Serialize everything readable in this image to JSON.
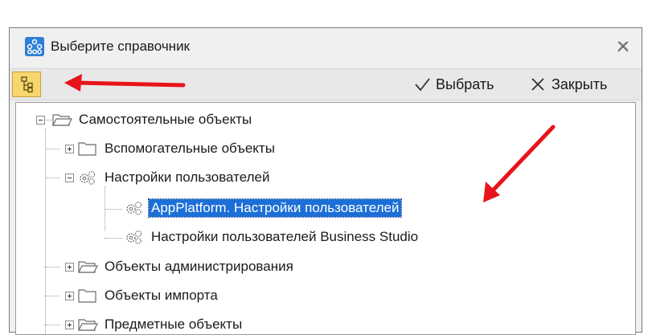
{
  "dialog": {
    "title": "Выберите справочник",
    "icons": {
      "app": "org-chart-icon",
      "close": "close-icon"
    }
  },
  "toolbar": {
    "tree_toggle_icon": "tree-view-icon",
    "select_label": "Выбрать",
    "close_label": "Закрыть",
    "icons": {
      "select": "checkmark-icon",
      "close": "x-icon"
    }
  },
  "tree": {
    "items": [
      {
        "label": "Самостоятельные объекты",
        "level": 0,
        "icon": "folder-open-icon",
        "expander": "minus"
      },
      {
        "label": "Вспомогательные объекты",
        "level": 1,
        "icon": "folder-icon",
        "expander": "plus"
      },
      {
        "label": "Настройки пользователей",
        "level": 1,
        "icon": "gears-icon",
        "expander": "minus"
      },
      {
        "label": "AppPlatform. Настройки пользователей",
        "level": 2,
        "icon": "gears-icon",
        "selected": true
      },
      {
        "label": "Настройки пользователей Business Studio",
        "level": 2,
        "icon": "gears-icon"
      },
      {
        "label": "Объекты администрирования",
        "level": 1,
        "icon": "folder-open-icon",
        "expander": "plus"
      },
      {
        "label": "Объекты импорта",
        "level": 1,
        "icon": "folder-icon",
        "expander": "plus"
      },
      {
        "label": "Предметные объекты",
        "level": 1,
        "icon": "folder-open-icon",
        "expander": "plus"
      }
    ]
  },
  "colors": {
    "selection": "#1c6fd6",
    "annotation_arrow": "#e8141b",
    "toggle_active": "#f7d66e"
  }
}
